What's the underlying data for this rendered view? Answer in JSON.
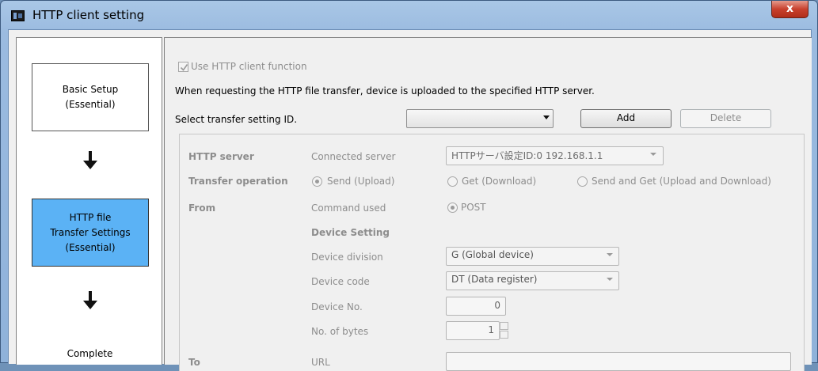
{
  "window": {
    "title": "HTTP client setting",
    "close_glyph": "x"
  },
  "steps": {
    "basic": {
      "line1": "Basic Setup",
      "line2": "(Essential)"
    },
    "http": {
      "line1": "HTTP file",
      "line2": "Transfer Settings",
      "line3": "(Essential)"
    },
    "complete": "Complete"
  },
  "main": {
    "use_http_label": "Use HTTP client function",
    "use_http_checked": true,
    "description": "When requesting the HTTP file transfer, device is uploaded to the specified HTTP server.",
    "select_id_label": "Select transfer setting ID.",
    "select_id_value": "",
    "add_label": "Add",
    "delete_label": "Delete"
  },
  "settings": {
    "http_server": {
      "label": "HTTP server",
      "sub": "Connected server",
      "value": "HTTPサーバ設定ID:0 192.168.1.1"
    },
    "transfer_operation": {
      "label": "Transfer operation",
      "options": [
        "Send (Upload)",
        "Get (Download)",
        "Send and Get (Upload and Download)"
      ],
      "selected": "Send (Upload)"
    },
    "from": {
      "label": "From",
      "sub": "Command used",
      "method": "POST"
    },
    "device_setting": {
      "heading": "Device Setting",
      "division_label": "Device division",
      "division_value": "G (Global device)",
      "code_label": "Device code",
      "code_value": "DT (Data register)",
      "no_label": "Device No.",
      "no_value": "0",
      "bytes_label": "No. of bytes",
      "bytes_value": "1"
    },
    "to": {
      "label": "To",
      "sub": "URL",
      "value": ""
    }
  },
  "colors": {
    "active_step": "#5bb2f5",
    "close_button": "#c8412e"
  }
}
